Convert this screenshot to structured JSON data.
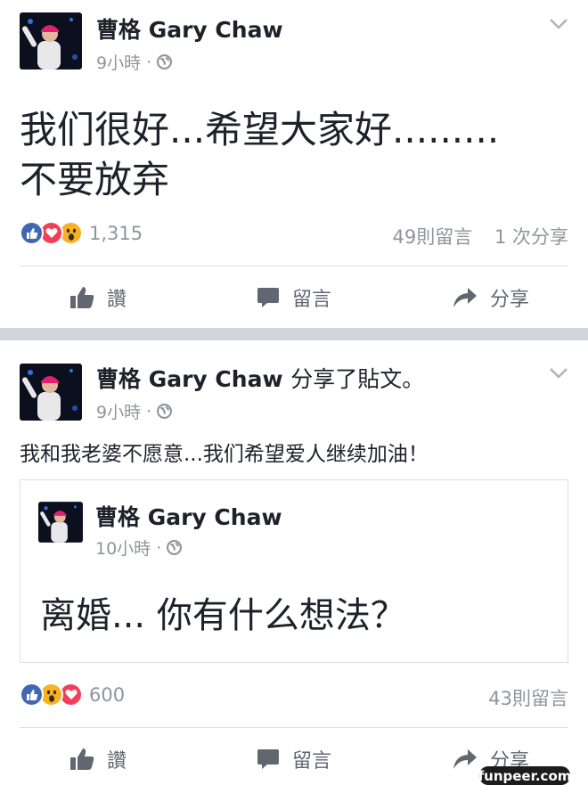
{
  "post1": {
    "author": "曹格 Gary Chaw",
    "time": "9小時",
    "dot": "·",
    "text_line1": "我们很好...希望大家好.........",
    "text_line2": "不要放弃",
    "reaction_count": "1,315",
    "comments": "49則留言",
    "shares": "1 次分享",
    "actions": {
      "like": "讚",
      "comment": "留言",
      "share": "分享"
    }
  },
  "post2": {
    "author": "曹格 Gary Chaw",
    "author_action": "分享了貼文。",
    "time": "9小時",
    "dot": "·",
    "text": "我和我老婆不愿意...我们希望爱人继续加油！",
    "shared": {
      "author": "曹格 Gary Chaw",
      "time": "10小時",
      "dot": "·",
      "text": "离婚... 你有什么想法？"
    },
    "reaction_count": "600",
    "comments": "43則留言",
    "actions": {
      "like": "讚",
      "comment": "留言",
      "share": "分享"
    }
  },
  "watermark": "funpeer.com",
  "colors": {
    "like_blue": "#4267b2",
    "love_red": "#f33e58",
    "wow_yellow": "#f7b125",
    "meta_gray": "#90949c",
    "separator": "#d1d5db"
  },
  "icons": [
    "chevron-down-icon",
    "globe-icon",
    "like-reaction-icon",
    "love-reaction-icon",
    "wow-reaction-icon",
    "thumbs-up-icon",
    "comment-icon",
    "share-arrow-icon"
  ]
}
